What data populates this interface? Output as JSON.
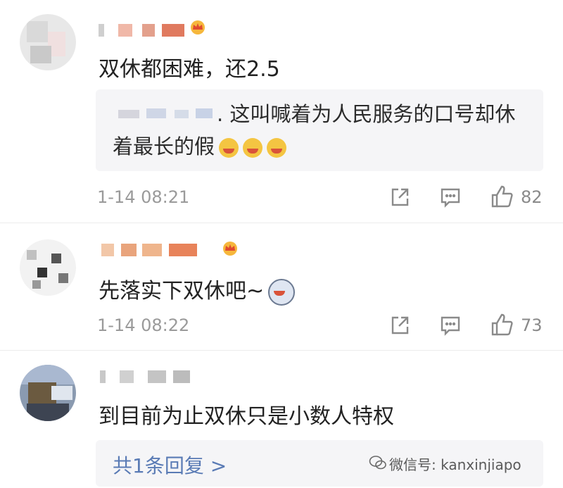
{
  "comments": [
    {
      "username": "",
      "text": "双休都困难，还2.5",
      "quote": {
        "line1": ". 这叫喊着为人民服务的口号却休",
        "line2": "着最长的假"
      },
      "time": "1-14 08:21",
      "likes": "82"
    },
    {
      "username": "",
      "text": "先落实下双休吧~",
      "time": "1-14 08:22",
      "likes": "73"
    },
    {
      "username": "",
      "text": "到目前为止双休只是小数人特权",
      "reply_link": "共1条回复 >"
    }
  ],
  "watermark": "微信号: kanxinjiapo",
  "icons": {
    "share": "share-icon",
    "comment": "comment-icon",
    "like": "thumbs-up-icon",
    "crown": "vip-crown-icon"
  }
}
